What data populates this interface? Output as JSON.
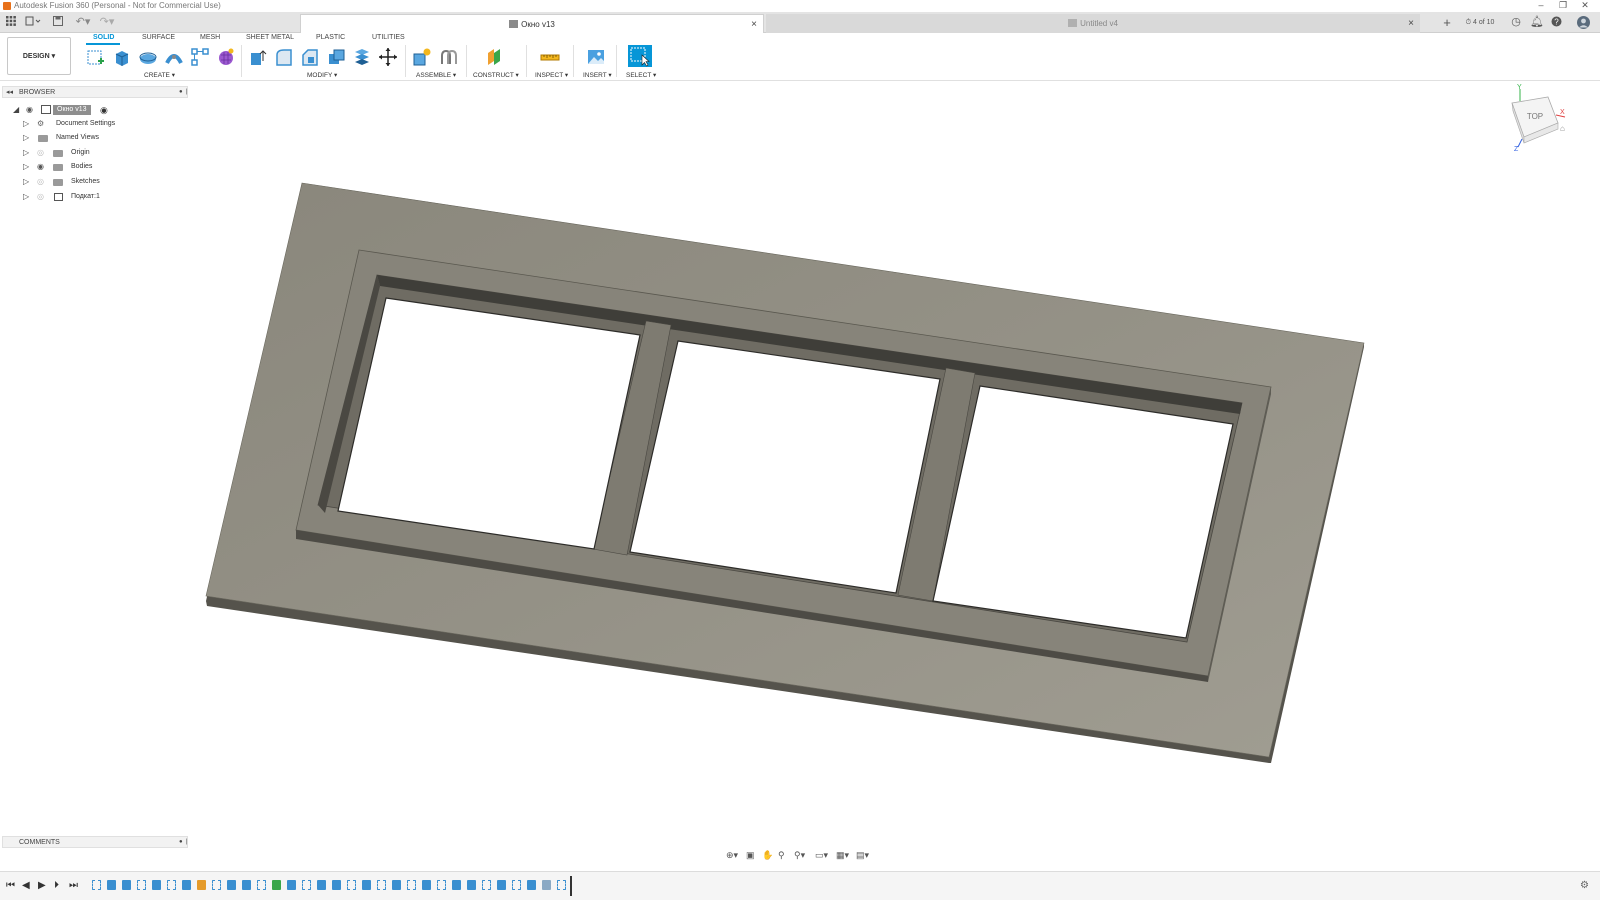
{
  "window": {
    "title": "Autodesk Fusion 360 (Personal - Not for Commercial Use)",
    "minimize": "–",
    "restore": "❐",
    "close": "✕"
  },
  "tabs": [
    {
      "label": "Окно v13",
      "active": true
    },
    {
      "label": "Untitled v4",
      "active": false
    }
  ],
  "tabbar": {
    "close_glyph": "×",
    "new_tab": "+",
    "job_status": "4 of 10"
  },
  "toolbar": {
    "workspace": "DESIGN ▾",
    "ribbon_tabs": [
      "SOLID",
      "SURFACE",
      "MESH",
      "SHEET METAL",
      "PLASTIC",
      "UTILITIES"
    ],
    "active_tab": "SOLID",
    "groups": [
      "CREATE ▾",
      "MODIFY ▾",
      "ASSEMBLE ▾",
      "CONSTRUCT ▾",
      "INSPECT ▾",
      "INSERT ▾",
      "SELECT ▾"
    ],
    "accent": "#0696d7"
  },
  "browser": {
    "title": "BROWSER",
    "root": "Окно v13",
    "items": [
      {
        "label": "Document Settings",
        "icon": "gear-icon"
      },
      {
        "label": "Named Views",
        "icon": "folder-icon"
      },
      {
        "label": "Origin",
        "icon": "folder-icon"
      },
      {
        "label": "Bodies",
        "icon": "folder-icon"
      },
      {
        "label": "Sketches",
        "icon": "folder-icon"
      },
      {
        "label": "Подкат:1",
        "icon": "component-icon"
      }
    ]
  },
  "comments": {
    "title": "COMMENTS"
  },
  "viewcube": {
    "face": "TOP",
    "axes": [
      "Y",
      "X",
      "Z"
    ]
  },
  "model": {
    "name": "window-frame",
    "color": "#8f8c82"
  }
}
